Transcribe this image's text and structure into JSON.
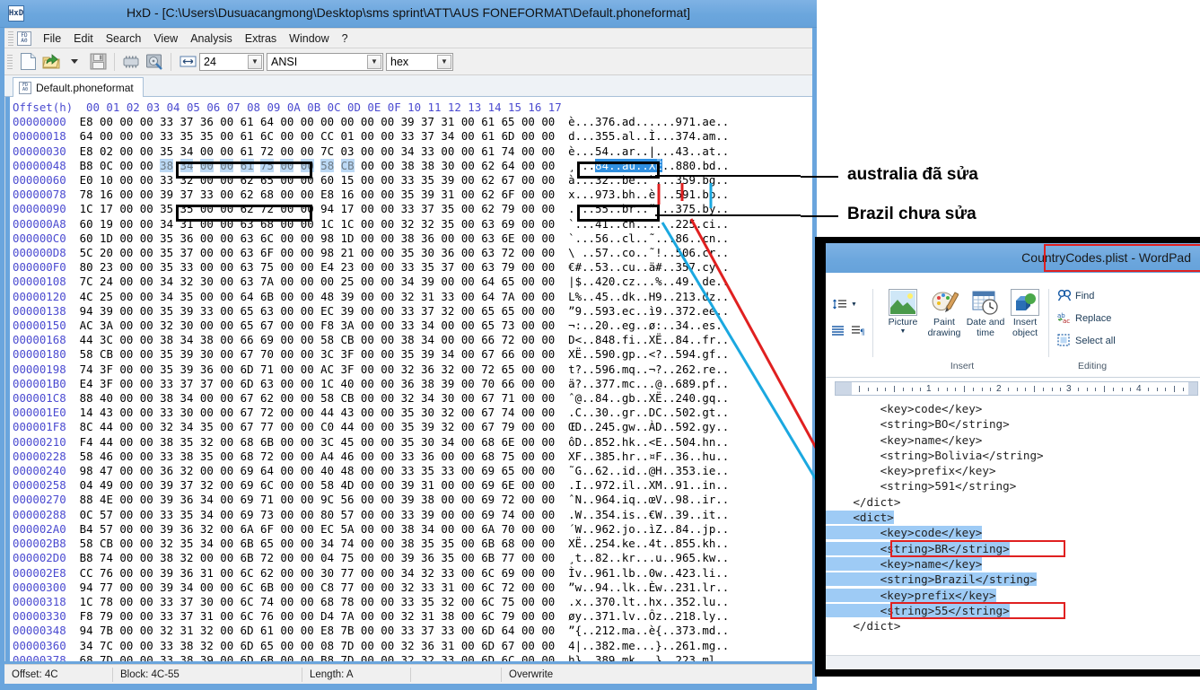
{
  "hxd": {
    "title": "HxD - [C:\\Users\\Dusuacangmong\\Desktop\\sms sprint\\ATT\\AUS FONEFORMAT\\Default.phoneformat]",
    "app_icon": "hxd-icon",
    "menu": [
      "File",
      "Edit",
      "Search",
      "View",
      "Analysis",
      "Extras",
      "Window",
      "?"
    ],
    "toolbar": {
      "bytes_per_row": "24",
      "encoding": "ANSI",
      "offset_base": "hex"
    },
    "tab": {
      "label": "Default.phoneformat"
    },
    "columns_header": "Offset(h)  00 01 02 03 04 05 06 07 08 09 0A 0B 0C 0D 0E 0F 10 11 12 13 14 15 16 17",
    "rows": [
      {
        "offset": "00000000",
        "hex": "E8 00 00 00 33 37 36 00 61 64 00 00 00 00 00 00 39 37 31 00 61 65 00 00",
        "ascii": "è...376.ad......971.ae.."
      },
      {
        "offset": "00000018",
        "hex": "64 00 00 00 33 35 35 00 61 6C 00 00 CC 01 00 00 33 37 34 00 61 6D 00 00",
        "ascii": "d...355.al..Ì...374.am.."
      },
      {
        "offset": "00000030",
        "hex": "E8 02 00 00 35 34 00 00 61 72 00 00 7C 03 00 00 34 33 00 00 61 74 00 00",
        "ascii": "è...54..ar..|...43..at.."
      },
      {
        "offset": "00000048",
        "hex": "B8 0C 00 00 38 34 00 00 61 75 00 00 58 CB 00 00 38 38 30 00 62 64 00 00",
        "ascii": "¸...84..au..XË..880.bd.."
      },
      {
        "offset": "00000060",
        "hex": "E0 10 00 00 33 32 00 00 62 65 00 00 60 15 00 00 33 35 39 00 62 67 00 00",
        "ascii": "à...32..be..`...359.bg.."
      },
      {
        "offset": "00000078",
        "hex": "78 16 00 00 39 37 33 00 62 68 00 00 E8 16 00 00 35 39 31 00 62 6F 00 00",
        "ascii": "x...973.bh..è...591.bo.."
      },
      {
        "offset": "00000090",
        "hex": "1C 17 00 00 35 35 00 00 62 72 00 00 94 17 00 00 33 37 35 00 62 79 00 00",
        "ascii": "....55..br..”...375.by.."
      },
      {
        "offset": "000000A8",
        "hex": "60 19 00 00 34 31 00 00 63 68 00 00 1C 1C 00 00 32 32 35 00 63 69 00 00",
        "ascii": "`...41..ch......225.ci.."
      },
      {
        "offset": "000000C0",
        "hex": "60 1D 00 00 35 36 00 00 63 6C 00 00 98 1D 00 00 38 36 00 00 63 6E 00 00",
        "ascii": "`...56..cl..˜...86..cn.."
      },
      {
        "offset": "000000D8",
        "hex": "5C 20 00 00 35 37 00 00 63 6F 00 00 98 21 00 00 35 30 36 00 63 72 00 00",
        "ascii": "\\ ..57..co..˜!..506.cr.."
      },
      {
        "offset": "000000F0",
        "hex": "80 23 00 00 35 33 00 00 63 75 00 00 E4 23 00 00 33 35 37 00 63 79 00 00",
        "ascii": "€#..53..cu..ä#..357.cy.."
      },
      {
        "offset": "00000108",
        "hex": "7C 24 00 00 34 32 30 00 63 7A 00 00 00 25 00 00 34 39 00 00 64 65 00 00",
        "ascii": "|$..420.cz...%..49..de.."
      },
      {
        "offset": "00000120",
        "hex": "4C 25 00 00 34 35 00 00 64 6B 00 00 48 39 00 00 32 31 33 00 64 7A 00 00",
        "ascii": "L%..45..dk..H9..213.dz.."
      },
      {
        "offset": "00000138",
        "hex": "94 39 00 00 35 39 33 00 65 63 00 00 EC 39 00 00 33 37 32 00 65 65 00 00",
        "ascii": "”9..593.ec..ì9..372.ee.."
      },
      {
        "offset": "00000150",
        "hex": "AC 3A 00 00 32 30 00 00 65 67 00 00 F8 3A 00 00 33 34 00 00 65 73 00 00",
        "ascii": "¬:..20..eg..ø:..34..es.."
      },
      {
        "offset": "00000168",
        "hex": "44 3C 00 00 38 34 38 00 66 69 00 00 58 CB 00 00 38 34 00 00 66 72 00 00",
        "ascii": "D<..848.fi..XË..84..fr.."
      },
      {
        "offset": "00000180",
        "hex": "58 CB 00 00 35 39 30 00 67 70 00 00 3C 3F 00 00 35 39 34 00 67 66 00 00",
        "ascii": "XË..590.gp..<?..594.gf.."
      },
      {
        "offset": "00000198",
        "hex": "74 3F 00 00 35 39 36 00 6D 71 00 00 AC 3F 00 00 32 36 32 00 72 65 00 00",
        "ascii": "t?..596.mq..¬?..262.re.."
      },
      {
        "offset": "000001B0",
        "hex": "E4 3F 00 00 33 37 37 00 6D 63 00 00 1C 40 00 00 36 38 39 00 70 66 00 00",
        "ascii": "ä?..377.mc...@..689.pf.."
      },
      {
        "offset": "000001C8",
        "hex": "88 40 00 00 38 34 00 00 67 62 00 00 58 CB 00 00 32 34 30 00 67 71 00 00",
        "ascii": "ˆ@..84..gb..XË..240.gq.."
      },
      {
        "offset": "000001E0",
        "hex": "14 43 00 00 33 30 00 00 67 72 00 00 44 43 00 00 35 30 32 00 67 74 00 00",
        "ascii": ".C..30..gr..DC..502.gt.."
      },
      {
        "offset": "000001F8",
        "hex": "8C 44 00 00 32 34 35 00 67 77 00 00 C0 44 00 00 35 39 32 00 67 79 00 00",
        "ascii": "ŒD..245.gw..ÀD..592.gy.."
      },
      {
        "offset": "00000210",
        "hex": "F4 44 00 00 38 35 32 00 68 6B 00 00 3C 45 00 00 35 30 34 00 68 6E 00 00",
        "ascii": "ôD..852.hk..<E..504.hn.."
      },
      {
        "offset": "00000228",
        "hex": "58 46 00 00 33 38 35 00 68 72 00 00 A4 46 00 00 33 36 00 00 68 75 00 00",
        "ascii": "XF..385.hr..¤F..36..hu.."
      },
      {
        "offset": "00000240",
        "hex": "98 47 00 00 36 32 00 00 69 64 00 00 40 48 00 00 33 35 33 00 69 65 00 00",
        "ascii": "˜G..62..id..@H..353.ie.."
      },
      {
        "offset": "00000258",
        "hex": "04 49 00 00 39 37 32 00 69 6C 00 00 58 4D 00 00 39 31 00 00 69 6E 00 00",
        "ascii": ".I..972.il..XM..91..in.."
      },
      {
        "offset": "00000270",
        "hex": "88 4E 00 00 39 36 34 00 69 71 00 00 9C 56 00 00 39 38 00 00 69 72 00 00",
        "ascii": "ˆN..964.iq..œV..98..ir.."
      },
      {
        "offset": "00000288",
        "hex": "0C 57 00 00 33 35 34 00 69 73 00 00 80 57 00 00 33 39 00 00 69 74 00 00",
        "ascii": ".W..354.is..€W..39..it.."
      },
      {
        "offset": "000002A0",
        "hex": "B4 57 00 00 39 36 32 00 6A 6F 00 00 EC 5A 00 00 38 34 00 00 6A 70 00 00",
        "ascii": "´W..962.jo..ìZ..84..jp.."
      },
      {
        "offset": "000002B8",
        "hex": "58 CB 00 00 32 35 34 00 6B 65 00 00 34 74 00 00 38 35 35 00 6B 68 00 00",
        "ascii": "XË..254.ke..4t..855.kh.."
      },
      {
        "offset": "000002D0",
        "hex": "B8 74 00 00 38 32 00 00 6B 72 00 00 04 75 00 00 39 36 35 00 6B 77 00 00",
        "ascii": "¸t..82..kr...u..965.kw.."
      },
      {
        "offset": "000002E8",
        "hex": "CC 76 00 00 39 36 31 00 6C 62 00 00 30 77 00 00 34 32 33 00 6C 69 00 00",
        "ascii": "Ìv..961.lb..0w..423.li.."
      },
      {
        "offset": "00000300",
        "hex": "94 77 00 00 39 34 00 00 6C 6B 00 00 C8 77 00 00 32 33 31 00 6C 72 00 00",
        "ascii": "”w..94..lk..Èw..231.lr.."
      },
      {
        "offset": "00000318",
        "hex": "1C 78 00 00 33 37 30 00 6C 74 00 00 68 78 00 00 33 35 32 00 6C 75 00 00",
        "ascii": ".x..370.lt..hx..352.lu.."
      },
      {
        "offset": "00000330",
        "hex": "F8 79 00 00 33 37 31 00 6C 76 00 00 D4 7A 00 00 32 31 38 00 6C 79 00 00",
        "ascii": "øy..371.lv..Ôz..218.ly.."
      },
      {
        "offset": "00000348",
        "hex": "94 7B 00 00 32 31 32 00 6D 61 00 00 E8 7B 00 00 33 37 33 00 6D 64 00 00",
        "ascii": "”{..212.ma..è{..373.md.."
      },
      {
        "offset": "00000360",
        "hex": "34 7C 00 00 33 38 32 00 6D 65 00 00 08 7D 00 00 32 36 31 00 6D 67 00 00",
        "ascii": "4|..382.me...}..261.mg.."
      },
      {
        "offset": "00000378",
        "hex": "68 7D 00 00 33 38 39 00 6D 6B 00 00 B8 7D 00 00 32 32 33 00 6D 6C 00 00",
        "ascii": "h}..389.mk..¸}..223.ml.."
      }
    ],
    "selection": {
      "row_index": 3,
      "hex_start_byte": 4,
      "hex_end_byte": 13,
      "ascii_start": 4,
      "ascii_end": 13
    },
    "statusbar": {
      "offset": "Offset: 4C",
      "block": "Block: 4C-55",
      "length": "Length: A",
      "mode": "Overwrite"
    }
  },
  "annotations": {
    "australia": "australia đã sửa",
    "brazil": "Brazil chưa sửa",
    "colors": {
      "red": "#e02020",
      "blue": "#1ba8e0",
      "black": "#000000"
    }
  },
  "wordpad": {
    "title": "CountryCodes.plist - WordPad",
    "ribbon": {
      "groups": [
        {
          "name": "Insert",
          "commands": [
            {
              "label": "Picture",
              "icon": "picture-icon",
              "has_dropdown": true
            },
            {
              "label": "Paint\ndrawing",
              "icon": "paint-drawing-icon",
              "has_dropdown": false
            },
            {
              "label": "Date and\ntime",
              "icon": "date-and-time-icon",
              "has_dropdown": false
            },
            {
              "label": "Insert\nobject",
              "icon": "insert-object-icon",
              "has_dropdown": false
            }
          ]
        },
        {
          "name": "Editing",
          "commands": [
            {
              "label": "Find",
              "icon": "find-icon"
            },
            {
              "label": "Replace",
              "icon": "replace-icon"
            },
            {
              "label": "Select all",
              "icon": "select-all-icon"
            }
          ]
        }
      ],
      "paragraph_icons": [
        "line-spacing-icon",
        "align-icon",
        "paragraph-icon"
      ]
    },
    "ruler": {
      "numbers": [
        "1",
        "2",
        "3",
        "4"
      ]
    },
    "document_lines": [
      {
        "text": "        <key>code</key>",
        "selected": false
      },
      {
        "text": "        <string>BO</string>",
        "selected": false
      },
      {
        "text": "        <key>name</key>",
        "selected": false
      },
      {
        "text": "        <string>Bolivia</string>",
        "selected": false
      },
      {
        "text": "        <key>prefix</key>",
        "selected": false
      },
      {
        "text": "        <string>591</string>",
        "selected": false
      },
      {
        "text": "    </dict>",
        "selected": false
      },
      {
        "text": "    <dict>",
        "selected": true
      },
      {
        "text": "        <key>code</key>",
        "selected": true
      },
      {
        "text": "        <string>BR</string>",
        "selected": true,
        "boxed": true
      },
      {
        "text": "        <key>name</key>",
        "selected": true
      },
      {
        "text": "        <string>Brazil</string>",
        "selected": true
      },
      {
        "text": "        <key>prefix</key>",
        "selected": true
      },
      {
        "text": "        <string>55</string>",
        "selected": true,
        "boxed": true
      },
      {
        "text": "    </dict>",
        "selected": false
      }
    ]
  }
}
